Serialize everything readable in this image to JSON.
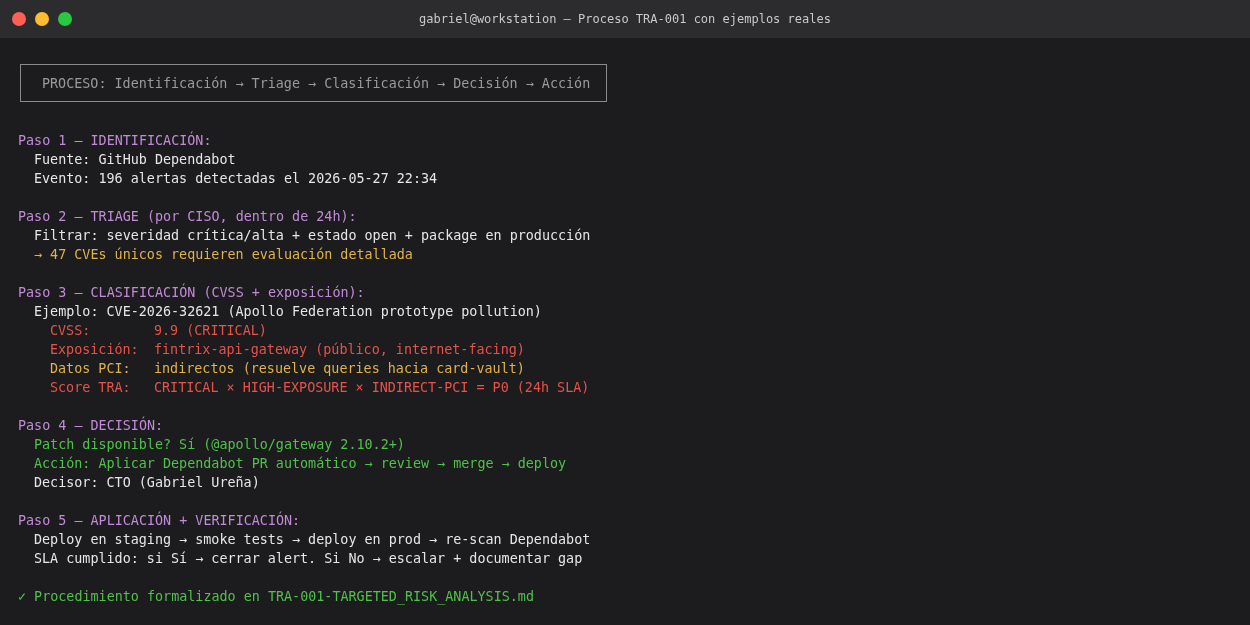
{
  "window": {
    "title": "gabriel@workstation — Proceso TRA-001 con ejemplos reales"
  },
  "process_box": {
    "text": "PROCESO: Identificación → Triage → Clasificación → Decisión → Acción"
  },
  "steps": [
    {
      "heading": "Paso 1 — IDENTIFICACIÓN:",
      "lines": [
        {
          "kind": "plain",
          "text": "Fuente: GitHub Dependabot"
        },
        {
          "kind": "plain",
          "text": "Evento: 196 alertas detectadas el 2026-05-27 22:34"
        }
      ]
    },
    {
      "heading": "Paso 2 — TRIAGE (por CISO, dentro de 24h):",
      "lines": [
        {
          "kind": "plain",
          "text": "Filtrar: severidad crítica/alta + estado open + package en producción"
        },
        {
          "kind": "note",
          "text": "→ 47 CVEs únicos requieren evaluación detallada"
        }
      ]
    },
    {
      "heading": "Paso 3 — CLASIFICACIÓN (CVSS + exposición):",
      "lines": [
        {
          "kind": "plain",
          "text": "Ejemplo: CVE-2026-32621 (Apollo Federation prototype pollution)",
          "children": [
            {
              "kind": "alert",
              "label": "CVSS:",
              "value": "9.9 (CRITICAL)"
            },
            {
              "kind": "alert",
              "label": "Exposición:",
              "value": "fintrix-api-gateway (público, internet-facing)"
            },
            {
              "kind": "note",
              "label": "Datos PCI:",
              "value": "indirectos (resuelve queries hacia card-vault)"
            },
            {
              "kind": "alert",
              "label": "Score TRA:",
              "value": "CRITICAL × HIGH-EXPOSURE × INDIRECT-PCI = P0 (24h SLA)"
            }
          ]
        }
      ]
    },
    {
      "heading": "Paso 4 — DECISIÓN:",
      "lines": [
        {
          "kind": "ok",
          "text": "Patch disponible? Sí (@apollo/gateway 2.10.2+)"
        },
        {
          "kind": "ok",
          "text": "Acción: Aplicar Dependabot PR automático → review → merge → deploy"
        },
        {
          "kind": "plain",
          "text": "Decisor: CTO (Gabriel Ureña)"
        }
      ]
    },
    {
      "heading": "Paso 5 — APLICACIÓN + VERIFICACIÓN:",
      "lines": [
        {
          "kind": "plain",
          "text": "Deploy en staging → smoke tests → deploy en prod → re-scan Dependabot"
        },
        {
          "kind": "plain",
          "text": "SLA cumplido: si Sí → cerrar alert. Si No → escalar + documentar gap"
        }
      ]
    }
  ],
  "footer": {
    "kind": "ok",
    "text": "✓ Procedimiento formalizado en TRA-001-TARGETED_RISK_ANALYSIS.md"
  }
}
